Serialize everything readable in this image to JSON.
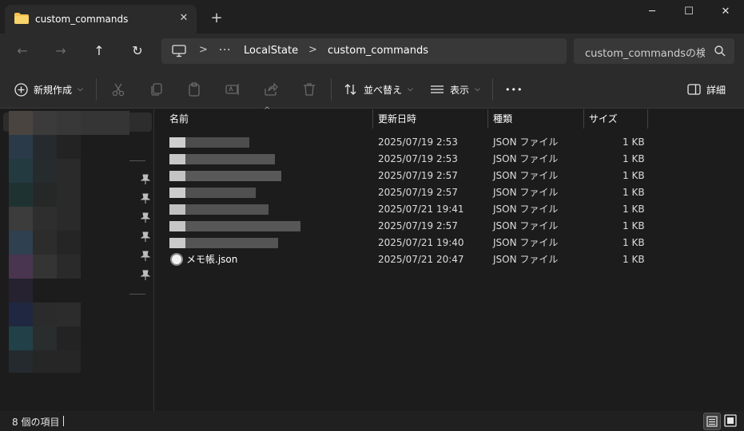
{
  "window": {
    "tab_title": "custom_commands",
    "tab_close": "✕",
    "new_tab": "+",
    "minimize": "─",
    "maximize": "☐",
    "close": "✕"
  },
  "address": {
    "back": "←",
    "forward": "→",
    "up": "↑",
    "refresh": "↻",
    "separator": ">",
    "ellipsis": "···",
    "crumbs": [
      "LocalState",
      "custom_commands"
    ],
    "search_placeholder": "custom_commandsの検索"
  },
  "toolbar": {
    "new_label": "新規作成",
    "sort_label": "並べ替え",
    "view_label": "表示",
    "more_label": "•••",
    "details_label": "詳細"
  },
  "columns": {
    "name": "名前",
    "modified": "更新日時",
    "type": "種類",
    "size": "サイズ",
    "sort_caret": "^"
  },
  "files": [
    {
      "name": "",
      "modified": "2025/07/19 2:53",
      "type": "JSON ファイル",
      "size": "1 KB"
    },
    {
      "name": "",
      "modified": "2025/07/19 2:53",
      "type": "JSON ファイル",
      "size": "1 KB"
    },
    {
      "name": "",
      "modified": "2025/07/19 2:57",
      "type": "JSON ファイル",
      "size": "1 KB"
    },
    {
      "name": "",
      "modified": "2025/07/19 2:57",
      "type": "JSON ファイル",
      "size": "1 KB"
    },
    {
      "name": "",
      "modified": "2025/07/21 19:41",
      "type": "JSON ファイル",
      "size": "1 KB"
    },
    {
      "name": "",
      "modified": "2025/07/19 2:57",
      "type": "JSON ファイル",
      "size": "1 KB"
    },
    {
      "name": "",
      "modified": "2025/07/21 19:40",
      "type": "JSON ファイル",
      "size": "1 KB"
    },
    {
      "name": "メモ帳.json",
      "modified": "2025/07/21 20:47",
      "type": "JSON ファイル",
      "size": "1 KB"
    }
  ],
  "status": {
    "item_count": "8 個の項目"
  },
  "colors": {
    "background": "#1c1c1c",
    "chrome": "#2b2b2b",
    "folder": "#f4c24d",
    "accent": "#4cc2ff"
  }
}
